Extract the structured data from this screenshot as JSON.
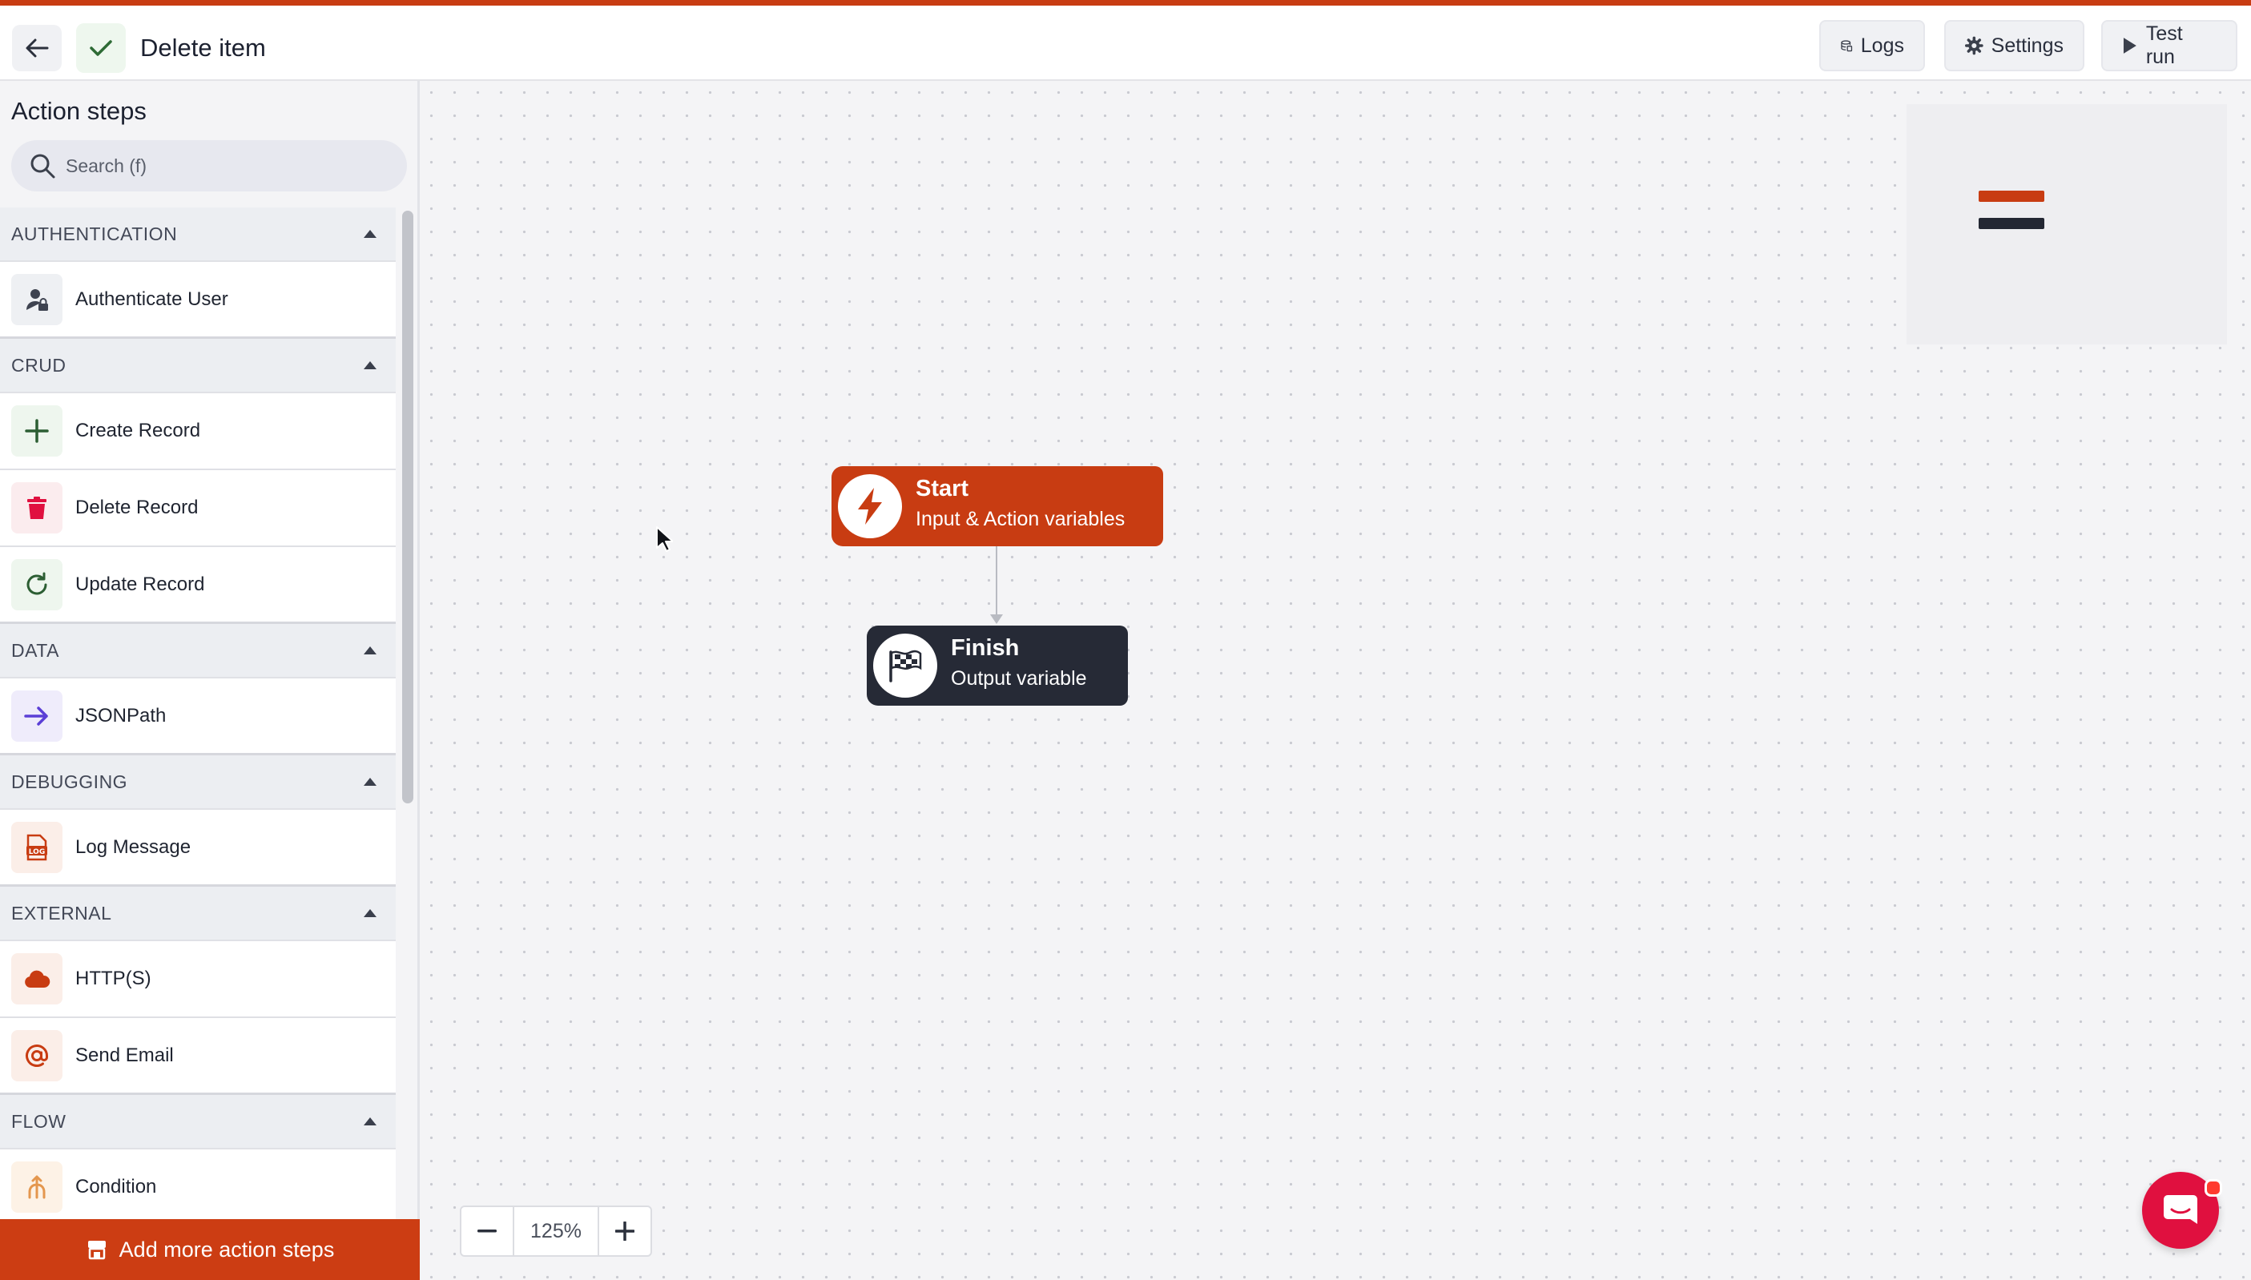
{
  "header": {
    "title": "Delete item",
    "logs_label": "Logs",
    "settings_label": "Settings",
    "test_run_label": "Test run"
  },
  "sidebar": {
    "title": "Action steps",
    "search_placeholder": "Search (f)",
    "sections": [
      {
        "label": "AUTHENTICATION",
        "items": [
          "Authenticate User"
        ]
      },
      {
        "label": "CRUD",
        "items": [
          "Create Record",
          "Delete Record",
          "Update Record"
        ]
      },
      {
        "label": "DATA",
        "items": [
          "JSONPath"
        ]
      },
      {
        "label": "DEBUGGING",
        "items": [
          "Log Message"
        ]
      },
      {
        "label": "EXTERNAL",
        "items": [
          "HTTP(S)",
          "Send Email"
        ]
      },
      {
        "label": "FLOW",
        "items": [
          "Condition"
        ]
      }
    ],
    "add_more_label": "Add more action steps"
  },
  "canvas": {
    "start_node": {
      "title": "Start",
      "subtitle": "Input & Action variables"
    },
    "finish_node": {
      "title": "Finish",
      "subtitle": "Output variable"
    },
    "zoom_level": "125%"
  },
  "colors": {
    "accent": "#c83c12",
    "dark_node": "#262a36",
    "chat": "#e0103f"
  },
  "icons": {
    "back": "arrow-left-icon",
    "status": "check-icon",
    "logs": "logs-icon",
    "settings": "gear-icon",
    "test_run": "play-icon",
    "search": "search-icon"
  }
}
